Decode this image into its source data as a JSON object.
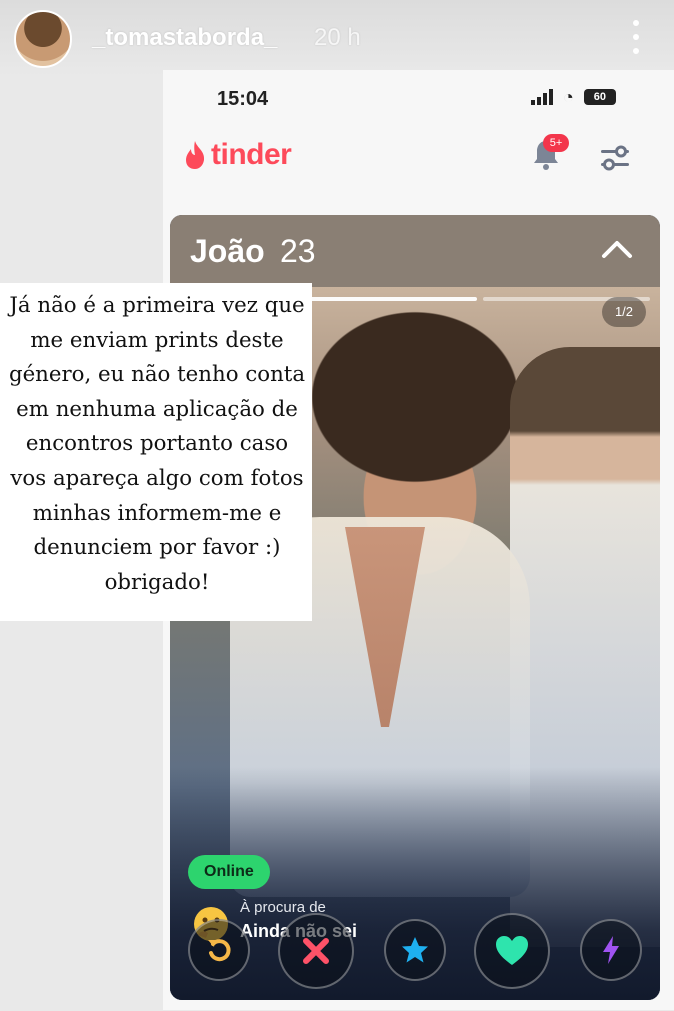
{
  "story": {
    "username": "_tomastaborda_",
    "time_ago": "20 h",
    "menu_icon": "more-vertical-icon"
  },
  "caption": "Já não é a primeira vez que me enviam prints deste género, eu não tenho conta em nenhuma aplicação de encontros portanto caso vos apareça algo com fotos minhas informem-me e denunciem por favor :) obrigado!",
  "phone": {
    "status_time": "15:04",
    "battery": "60",
    "brand": "tinder",
    "notification_badge": "5+",
    "colors": {
      "brand": "#fd4a5a",
      "online": "#2dd46e",
      "header": "#8a7f74"
    }
  },
  "profile": {
    "name": "João",
    "age": "23",
    "photo_counter": "1/2",
    "online_label": "Online",
    "looking_for_label": "À procura de",
    "looking_for_value": "Ainda não sei",
    "looking_for_emoji": "thinking-face-icon"
  },
  "actions": [
    {
      "name": "rewind",
      "icon": "rewind-icon",
      "color": "#f5b748"
    },
    {
      "name": "nope",
      "icon": "close-icon",
      "color": "#fe5268"
    },
    {
      "name": "super-like",
      "icon": "star-icon",
      "color": "#1eb0f0"
    },
    {
      "name": "like",
      "icon": "heart-icon",
      "color": "#2ee4ad"
    },
    {
      "name": "boost",
      "icon": "bolt-icon",
      "color": "#a053f2"
    }
  ]
}
